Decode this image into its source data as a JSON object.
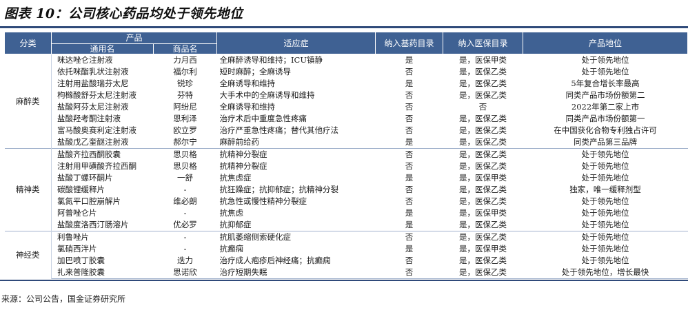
{
  "title": "图表 10：公司核心药品均处于领先地位",
  "header": {
    "category": "分类",
    "product": "产品",
    "generic_name": "通用名",
    "brand_name": "商品名",
    "indication": "适应症",
    "essential_list": "纳入基药目录",
    "insurance_list": "纳入医保目录",
    "position": "产品地位"
  },
  "groups": [
    {
      "category": "麻醉类",
      "rows": [
        {
          "generic": "咪达唑仑注射液",
          "brand": "力月西",
          "indication": "全麻醉诱导和维持；ICU镇静",
          "essential": "是",
          "insurance": "是，医保甲类",
          "position": "处于领先地位"
        },
        {
          "generic": "依托咪酯乳状注射液",
          "brand": "福尔利",
          "indication": "短时麻醉；全麻诱导",
          "essential": "否",
          "insurance": "是，医保乙类",
          "position": "处于领先地位"
        },
        {
          "generic": "注射用盐酸瑞芬太尼",
          "brand": "锐珍",
          "indication": "全麻诱导和维持",
          "essential": "是",
          "insurance": "是，医保乙类",
          "position": "5年复合增长率最高"
        },
        {
          "generic": "枸橼酸舒芬太尼注射液",
          "brand": "芬特",
          "indication": "大手术中的全麻诱导和维持",
          "essential": "否",
          "insurance": "是，医保乙类",
          "position": "同类产品市场份额第二"
        },
        {
          "generic": "盐酸阿芬太尼注射液",
          "brand": "阿纷尼",
          "indication": "全麻诱导和维持",
          "essential": "否",
          "insurance": "否",
          "position": "2022年第二家上市"
        },
        {
          "generic": "盐酸羟考酮注射液",
          "brand": "恩利泽",
          "indication": "治疗术后中重度急性疼痛",
          "essential": "否",
          "insurance": "是，医保乙类",
          "position": "同类产品市场份额第一"
        },
        {
          "generic": "富马酸奥赛利定注射液",
          "brand": "欧立罗",
          "indication": "治疗严重急性疼痛；替代其他疗法",
          "essential": "否",
          "insurance": "是，医保乙类",
          "position": "在中国获化合物专利独占许可"
        },
        {
          "generic": "盐酸戊乙奎醚注射液",
          "brand": "郝尔宁",
          "indication": "麻醉前给药",
          "essential": "是",
          "insurance": "是，医保乙类",
          "position": "同类产品第三品牌"
        }
      ]
    },
    {
      "category": "精神类",
      "rows": [
        {
          "generic": "盐酸齐拉西酮胶囊",
          "brand": "思贝格",
          "indication": "抗精神分裂症",
          "essential": "否",
          "insurance": "是，医保乙类",
          "position": "处于领先地位"
        },
        {
          "generic": "注射用甲磺酸齐拉西酮",
          "brand": "思贝格",
          "indication": "抗精神分裂症",
          "essential": "否",
          "insurance": "是，医保乙类",
          "position": "处于领先地位"
        },
        {
          "generic": "盐酸丁螺环酮片",
          "brand": "一舒",
          "indication": "抗焦虑症",
          "essential": "是",
          "insurance": "是，医保甲类",
          "position": "处于领先地位"
        },
        {
          "generic": "碳酸锂缓释片",
          "brand": "-",
          "indication": "抗狂躁症；抗抑郁症；抗精神分裂",
          "essential": "否",
          "insurance": "是，医保乙类",
          "position": "独家，唯一缓释剂型"
        },
        {
          "generic": "氯氮平口腔崩解片",
          "brand": "维必朗",
          "indication": "抗急性或慢性精神分裂症",
          "essential": "否",
          "insurance": "是，医保乙类",
          "position": "处于领先地位"
        },
        {
          "generic": "阿普唑仑片",
          "brand": "-",
          "indication": "抗焦虑",
          "essential": "是",
          "insurance": "是，医保甲类",
          "position": "处于领先地位"
        },
        {
          "generic": "盐酸度洛西汀肠溶片",
          "brand": "优必罗",
          "indication": "抗抑郁症",
          "essential": "是",
          "insurance": "是，医保乙类",
          "position": "处于领先地位"
        }
      ]
    },
    {
      "category": "神经类",
      "rows": [
        {
          "generic": "利鲁唑片",
          "brand": "-",
          "indication": "抗肌萎缩侧索硬化症",
          "essential": "否",
          "insurance": "是，医保乙类",
          "position": "处于领先地位"
        },
        {
          "generic": "氯硝西泮片",
          "brand": "-",
          "indication": "抗癫痫",
          "essential": "是",
          "insurance": "是，医保甲类",
          "position": "处于领先地位"
        },
        {
          "generic": "加巴喷丁胶囊",
          "brand": "迭力",
          "indication": "治疗成人疱疹后神经痛；抗癫痫",
          "essential": "否",
          "insurance": "是，医保乙类",
          "position": "处于领先地位"
        },
        {
          "generic": "扎来普隆胶囊",
          "brand": "思诺欣",
          "indication": "治疗短期失眠",
          "essential": "否",
          "insurance": "是，医保乙类",
          "position": "处于领先地位，增长最快"
        }
      ]
    }
  ],
  "source": "来源：公司公告，国金证券研究所"
}
